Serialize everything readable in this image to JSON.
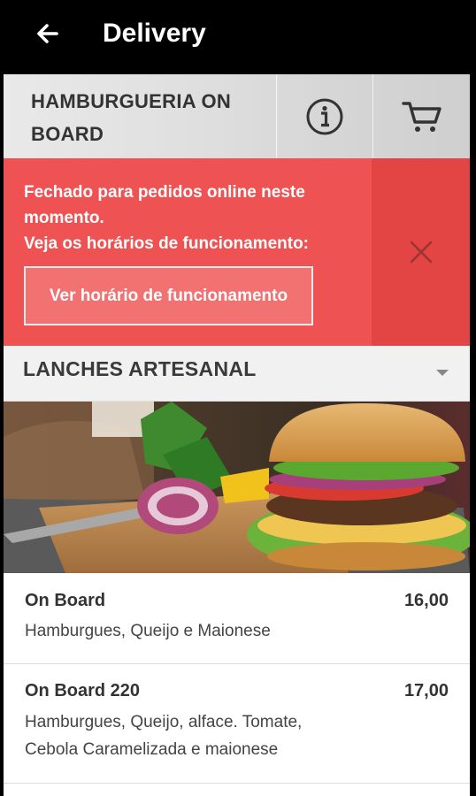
{
  "header": {
    "title": "Delivery",
    "back_icon": "arrow-left-icon"
  },
  "restaurant": {
    "name": "HAMBURGUERIA ON BOARD",
    "info_icon": "info-icon",
    "cart_icon": "cart-icon"
  },
  "notice": {
    "line1": "Fechado para pedidos online neste momento.",
    "line2": "Veja os horários de funcionamento:",
    "button_label": "Ver horário de funcionamento",
    "close_icon": "close-icon",
    "color": "#ef5252"
  },
  "category": {
    "label": "LANCHES ARTESANAL",
    "caret_icon": "caret-down-icon"
  },
  "menu": {
    "items": [
      {
        "name": "On Board",
        "price": "16,00",
        "desc_line1": "Hamburgues, Queijo e Maionese",
        "desc_line2": ""
      },
      {
        "name": "On Board 220",
        "price": "17,00",
        "desc_line1": "Hamburgues, Queijo, alface. Tomate,",
        "desc_line2": "Cebola Caramelizada e maionese"
      }
    ]
  }
}
